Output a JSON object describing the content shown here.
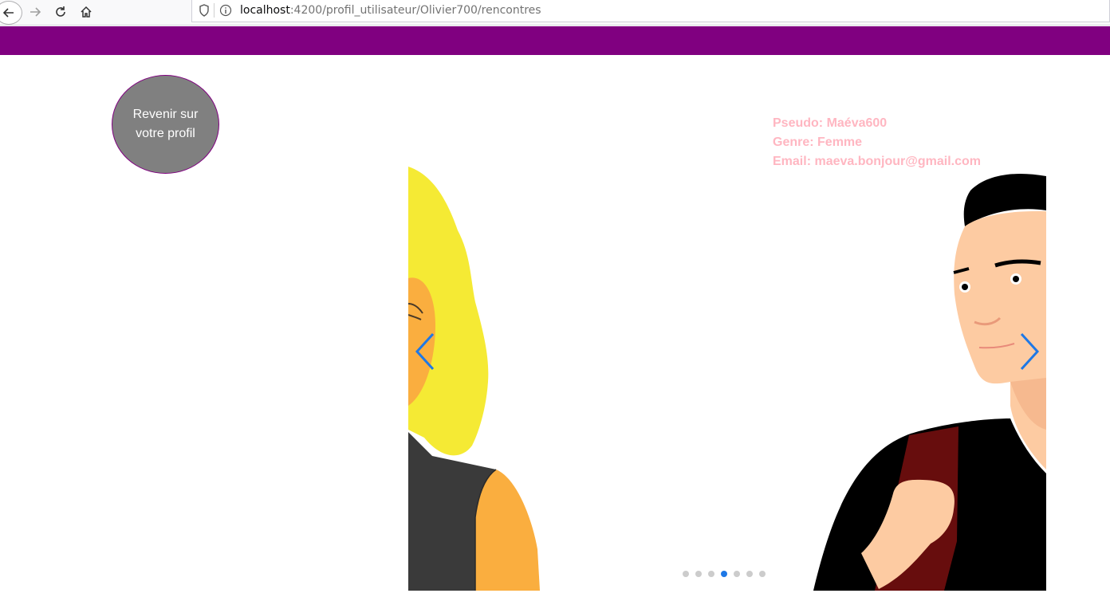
{
  "browser": {
    "url_host": "localhost",
    "url_path": ":4200/profil_utilisateur/Olivier700/rencontres"
  },
  "back_button": {
    "line1": "Revenir sur",
    "line2": "votre profil"
  },
  "profile": {
    "pseudo": "Pseudo: Maéva600",
    "genre": "Genre: Femme",
    "email": "Email: maeva.bonjour@gmail.com"
  },
  "colors": {
    "header": "#800080",
    "button_bg": "#808080",
    "profile_text": "#ffb6c1",
    "carousel_control": "#1e78e6"
  },
  "carousel": {
    "slide_count": 7,
    "active_index": 3
  }
}
